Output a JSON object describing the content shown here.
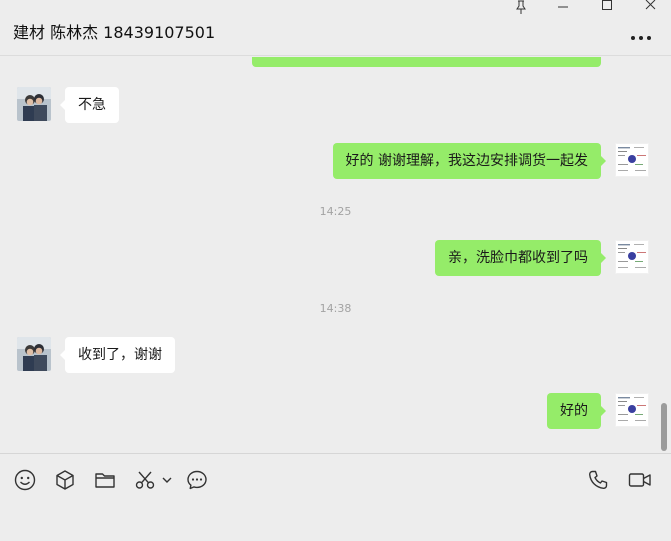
{
  "window": {
    "title": "建材 陈林杰 18439107501",
    "controls": [
      "pin-icon",
      "minimize-icon",
      "maximize-icon",
      "close-icon"
    ],
    "more_icon": "more-horizontal-icon"
  },
  "messages": [
    {
      "type": "out",
      "text": "",
      "partial": true
    },
    {
      "type": "in",
      "text": "不急"
    },
    {
      "type": "out",
      "text": "好的 谢谢理解，我这边安排调货一起发"
    },
    {
      "type": "time",
      "text": "14:25"
    },
    {
      "type": "out",
      "text": "亲，洗脸巾都收到了吗"
    },
    {
      "type": "time",
      "text": "14:38"
    },
    {
      "type": "in",
      "text": "收到了，谢谢"
    },
    {
      "type": "out",
      "text": "好的"
    }
  ],
  "toolbar": {
    "left_icons": [
      "emoji-icon",
      "favorites-cube-icon",
      "folder-icon",
      "scissors-screenshot-icon",
      "chevron-down-icon",
      "chat-history-icon"
    ],
    "right_icons": [
      "voice-call-icon",
      "video-call-icon"
    ]
  },
  "colors": {
    "background": "#ededed",
    "outgoing_bubble": "#95ec69",
    "incoming_bubble": "#ffffff",
    "timestamp": "#a3a3a3"
  }
}
